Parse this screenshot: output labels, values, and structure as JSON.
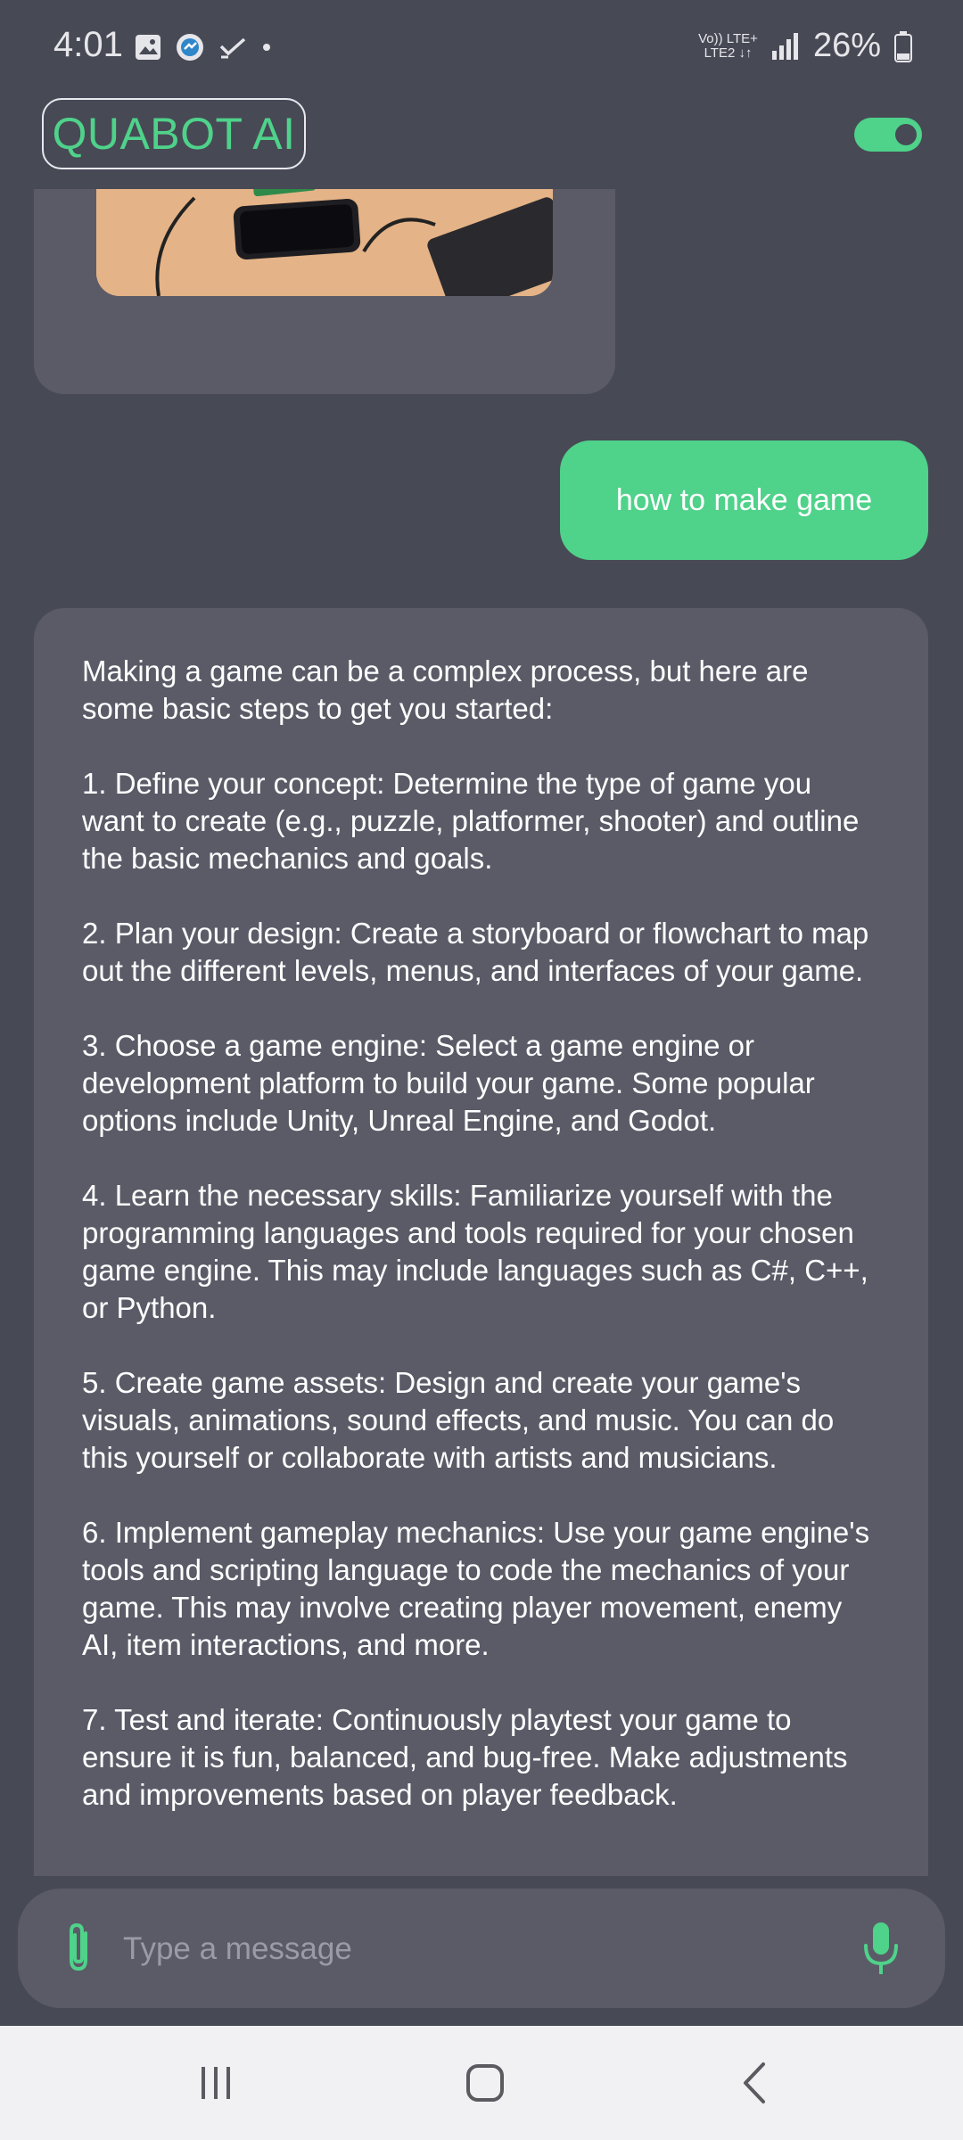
{
  "status_bar": {
    "time": "4:01",
    "network_top": "Vo)) LTE+",
    "network_bottom": "LTE2 ↓↑",
    "battery": "26%"
  },
  "header": {
    "title": "QUABOT AI",
    "toggle_on": true
  },
  "colors": {
    "accent": "#4fd28a",
    "background": "#474955",
    "bubble": "#5a5b67"
  },
  "messages": {
    "user_query": "how to make game",
    "bot_reply": [
      "Making a game can be a complex process, but here are some basic steps to get you started:",
      "1. Define your concept: Determine the type of game you want to create (e.g., puzzle, platformer, shooter) and outline the basic mechanics and goals.",
      "2. Plan your design: Create a storyboard or flowchart to map out the different levels, menus, and interfaces of your game.",
      "3. Choose a game engine: Select a game engine or development platform to build your game. Some popular options include Unity, Unreal Engine, and Godot.",
      "4. Learn the necessary skills: Familiarize yourself with the programming languages and tools required for your chosen game engine. This may include languages such as C#, C++, or Python.",
      "5. Create game assets: Design and create your game's visuals, animations, sound effects, and music. You can do this yourself or collaborate with artists and musicians.",
      "6. Implement gameplay mechanics: Use your game engine's tools and scripting language to code the mechanics of your game. This may involve creating player movement, enemy AI, item interactions, and more.",
      "7. Test and iterate: Continuously playtest your game to ensure it is fun, balanced, and bug-free. Make adjustments and improvements based on player feedback."
    ]
  },
  "composer": {
    "placeholder": "Type a message",
    "attach_icon": "paperclip-icon",
    "mic_icon": "microphone-icon"
  },
  "nav": {
    "recent_icon": "recent-apps-icon",
    "home_icon": "home-icon",
    "back_icon": "back-icon"
  }
}
